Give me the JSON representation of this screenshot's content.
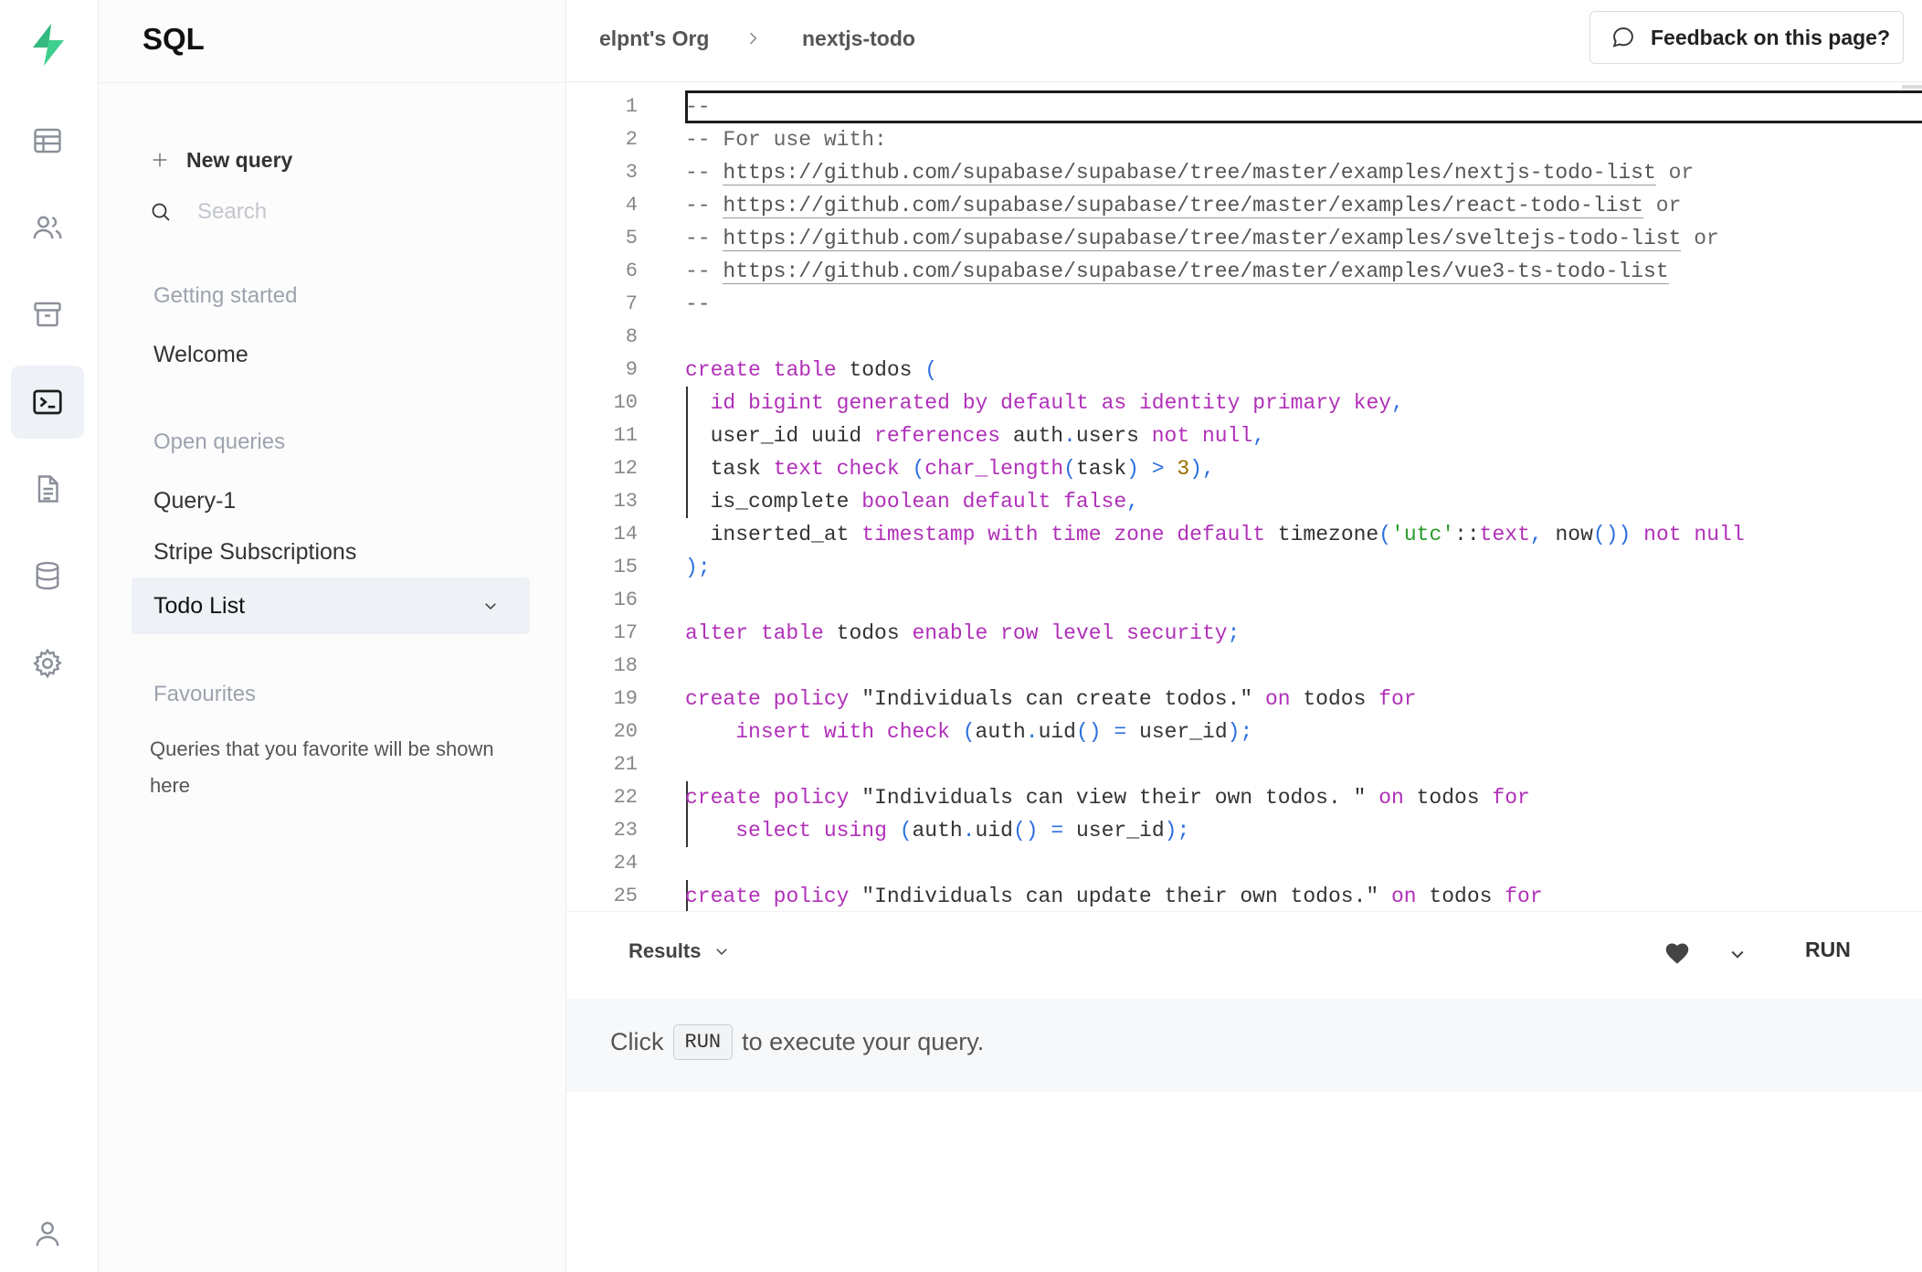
{
  "app": {
    "section_title": "SQL"
  },
  "rail": {
    "items": [
      {
        "name": "table-editor-icon"
      },
      {
        "name": "users-icon"
      },
      {
        "name": "storage-icon"
      },
      {
        "name": "sql-terminal-icon",
        "active": true
      },
      {
        "name": "docs-icon"
      },
      {
        "name": "database-icon"
      },
      {
        "name": "settings-icon"
      },
      {
        "name": "account-icon"
      }
    ],
    "brand_color": "#3ecf8e"
  },
  "sidebar": {
    "new_query": "New query",
    "search_placeholder": "Search",
    "getting_started": {
      "heading": "Getting started",
      "items": [
        "Welcome"
      ]
    },
    "open_queries": {
      "heading": "Open queries",
      "items": [
        "Query-1",
        "Stripe Subscriptions",
        "Todo List"
      ],
      "selected": "Todo List"
    },
    "favourites": {
      "heading": "Favourites",
      "empty_text": "Queries that you favorite will be shown here"
    }
  },
  "header": {
    "breadcrumb": [
      "elpnt's Org",
      "nextjs-todo"
    ],
    "feedback_label": "Feedback on this page?"
  },
  "editor": {
    "line_numbers": [
      "1",
      "2",
      "3",
      "4",
      "5",
      "6",
      "7",
      "8",
      "9",
      "10",
      "11",
      "12",
      "13",
      "14",
      "15",
      "16",
      "17",
      "18",
      "19",
      "20",
      "21",
      "22",
      "23",
      "24",
      "25"
    ],
    "lines": [
      "--",
      "-- For use with:",
      "-- https://github.com/supabase/supabase/tree/master/examples/nextjs-todo-list or",
      "-- https://github.com/supabase/supabase/tree/master/examples/react-todo-list or",
      "-- https://github.com/supabase/supabase/tree/master/examples/sveltejs-todo-list or",
      "-- https://github.com/supabase/supabase/tree/master/examples/vue3-ts-todo-list",
      "--",
      "",
      "create table todos (",
      "  id bigint generated by default as identity primary key,",
      "  user_id uuid references auth.users not null,",
      "  task text check (char_length(task) > 3),",
      "  is_complete boolean default false,",
      "  inserted_at timestamp with time zone default timezone('utc'::text, now()) not null",
      ");",
      "",
      "alter table todos enable row level security;",
      "",
      "create policy \"Individuals can create todos.\" on todos for",
      "    insert with check (auth.uid() = user_id);",
      "",
      "create policy \"Individuals can view their own todos. \" on todos for",
      "    select using (auth.uid() = user_id);",
      "",
      "create policy \"Individuals can update their own todos.\" on todos for"
    ],
    "syntax_colors": {
      "keyword": "#b030b8",
      "punctuation": "#2c6fe0",
      "number": "#9a6b00",
      "string": "#2a9a2a",
      "comment": "#666666"
    }
  },
  "results": {
    "label": "Results",
    "run_label": "RUN",
    "hint_prefix": "Click",
    "hint_key": "RUN",
    "hint_suffix": "to execute your query."
  }
}
